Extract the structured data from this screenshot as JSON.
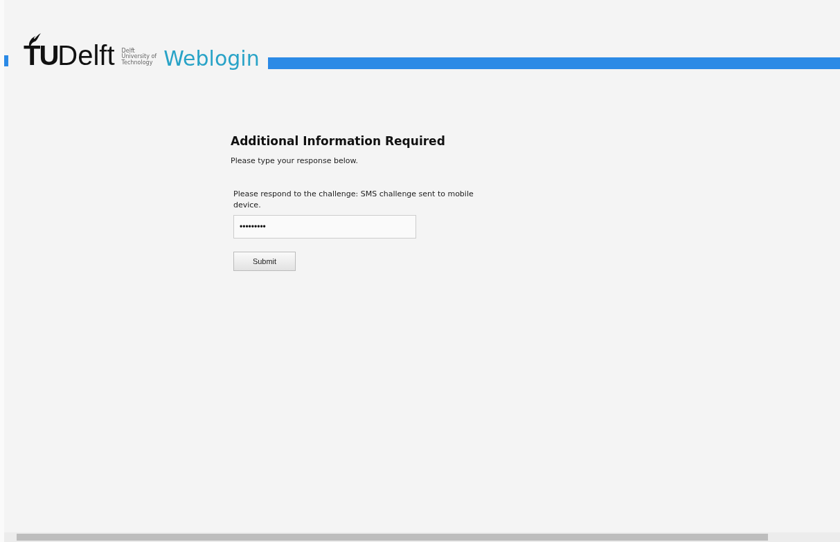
{
  "header": {
    "logo_mark": "TU",
    "logo_word": "Delft",
    "logo_tagline": [
      "Delft",
      "University of",
      "Technology"
    ],
    "app_title": "Weblogin"
  },
  "form": {
    "title": "Additional Information Required",
    "subtitle": "Please type your response below.",
    "prompt": "Please respond to the challenge: SMS challenge sent to mobile device.",
    "response_value": "•••••••••",
    "submit": "Submit"
  }
}
